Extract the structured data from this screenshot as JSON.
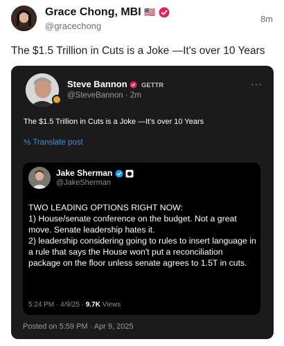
{
  "post": {
    "author_name": "Grace Chong, MBI",
    "flag_emoji": "🇺🇸",
    "author_handle": "@gracechong",
    "time": "8m",
    "text": "The $1.5 Trillion in Cuts is a Joke —It's over 10 Years"
  },
  "card": {
    "name": "Steve Bannon",
    "network_label": "GETTR",
    "handle_time": "@SteveBannon · 2m",
    "menu": "···",
    "text": "The $1.5 Trillion in Cuts is a Joke —It's over 10 Years",
    "translate_label": "Translate post",
    "posted_on": "Posted on 5:59 PM · Apr 9, 2025"
  },
  "inner": {
    "name": "Jake Sherman",
    "handle": "@JakeSherman",
    "lines": [
      "TWO LEADING OPTIONS RIGHT NOW:",
      "1) House/senate conference on the budget. Not a great move. Senate leadership hates it.",
      "2) leadership considering going to rules to insert language in a rule that says the House won't put a reconciliation package on the floor unless senate agrees to 1.5T in cuts."
    ],
    "timestamp": "5:24 PM · 4/9/25 · ",
    "views_count": "9.7K",
    "views_label": " Views"
  },
  "colors": {
    "verified_blue": "#1d9bf0",
    "verified_pink": "#e0245e",
    "link_blue": "#3d8fe6",
    "badge_orange": "#e3a33b"
  }
}
